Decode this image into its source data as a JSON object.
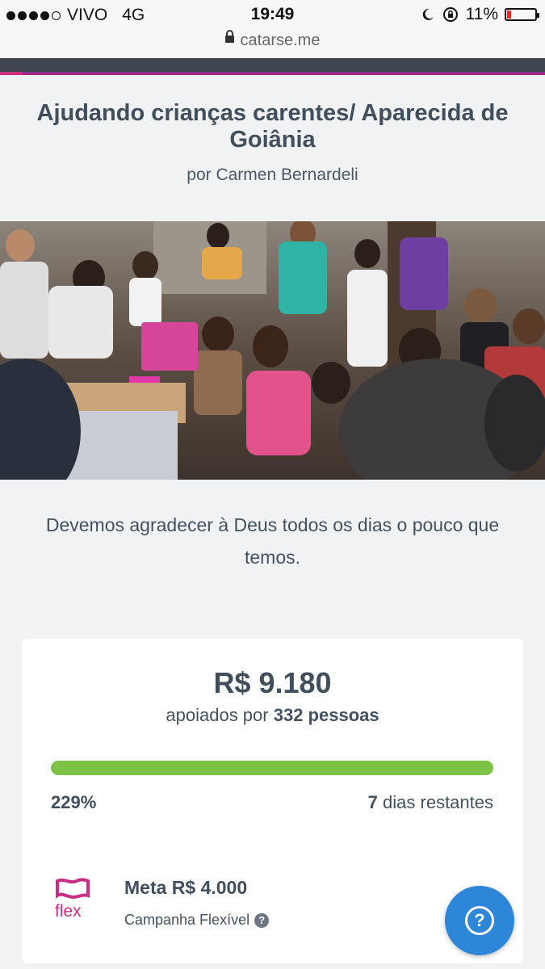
{
  "status_bar": {
    "carrier": "VIVO",
    "network": "4G",
    "time": "19:49",
    "battery": "11%",
    "battery_level": 0.11
  },
  "browser": {
    "url": "catarse.me"
  },
  "project": {
    "title": "Ajudando crianças carentes/ Aparecida de Goiânia",
    "byline": "por Carmen Bernardeli",
    "tagline": "Devemos agradecer à Deus todos os dias o pouco que temos."
  },
  "stats": {
    "amount": "R$ 9.180",
    "backers_prefix": "apoiados por",
    "backers_count": "332 pessoas",
    "progress_fraction": 1.0,
    "percent": "229%",
    "days_number": "7",
    "days_suffix": "dias restantes",
    "goal": "Meta R$ 4.000",
    "campaign_type": "Campanha Flexível",
    "flex_label": "flex"
  },
  "colors": {
    "progress": "#7cc245",
    "brand": "#c82d83",
    "help_button": "#2e86d8"
  },
  "icons": {
    "help": "help-question-icon",
    "info": "question-circle-icon"
  }
}
